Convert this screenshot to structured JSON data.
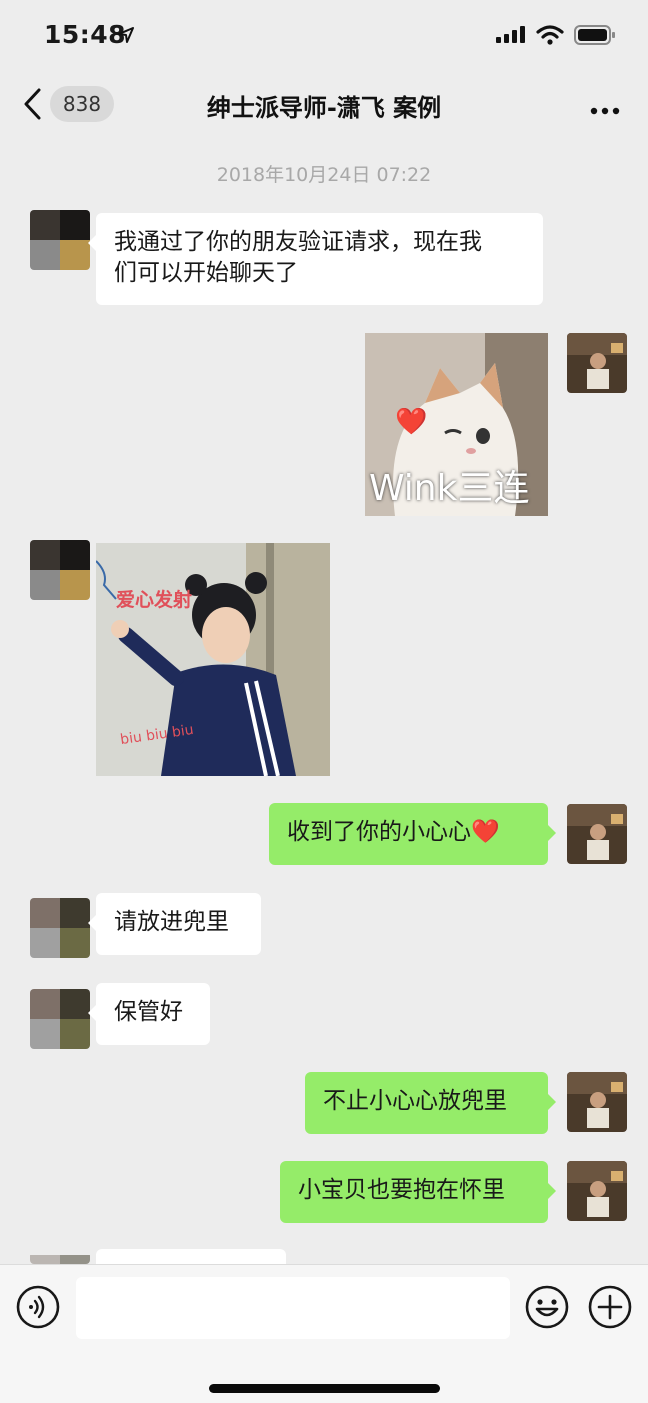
{
  "status_bar": {
    "time": "15:48"
  },
  "nav": {
    "back_count": "838",
    "title": "绅士派导师-潇飞 案例"
  },
  "chat": {
    "timestamp": "2018年10月24日 07:22",
    "messages": [
      {
        "side": "left",
        "type": "text",
        "text_line1": "我通过了你的朋友验证请求，现在我",
        "text_line2": "们可以开始聊天了"
      },
      {
        "side": "right",
        "type": "sticker",
        "caption": "Wink三连",
        "heart": "❤️"
      },
      {
        "side": "left",
        "type": "sticker",
        "caption_top": "爱心发射",
        "caption_bottom": "biu  biu  biu"
      },
      {
        "side": "right",
        "type": "text",
        "text": "收到了你的小心心",
        "emoji": "❤️"
      },
      {
        "side": "left",
        "type": "text",
        "text": "请放进兜里"
      },
      {
        "side": "left",
        "type": "text",
        "text": "保管好"
      },
      {
        "side": "right",
        "type": "text",
        "text": "不止小心心放兜里"
      },
      {
        "side": "right",
        "type": "text",
        "text": "小宝贝也要抱在怀里"
      }
    ]
  },
  "input_bar": {
    "value": "",
    "placeholder": ""
  },
  "icons": {
    "back": "chevron-left-icon",
    "more": "more-dots-icon",
    "voice": "voice-icon",
    "emoji": "emoji-icon",
    "plus": "plus-icon"
  },
  "colors": {
    "background": "#ededed",
    "bubble_self": "#95ec69",
    "bubble_other": "#ffffff"
  }
}
